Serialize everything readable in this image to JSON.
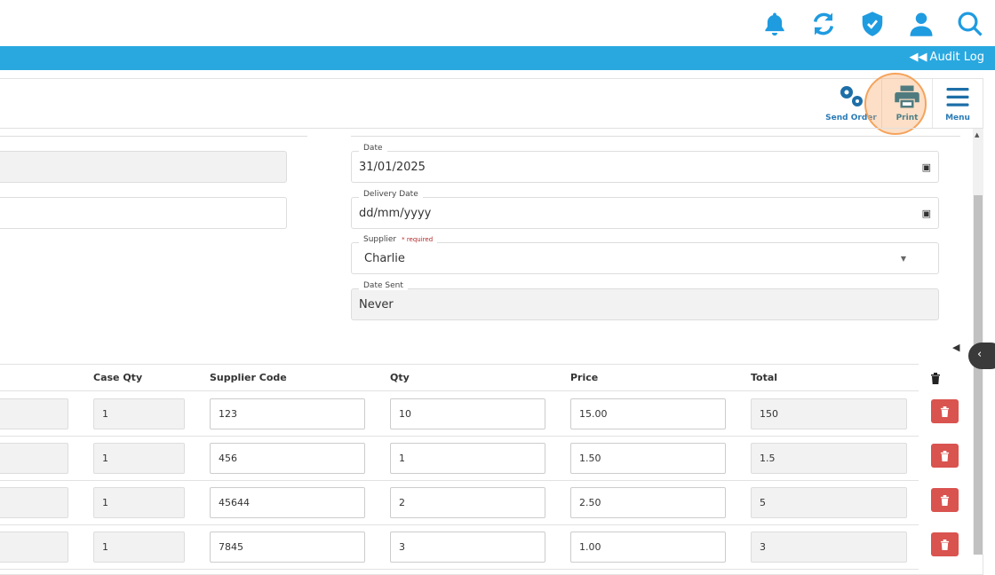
{
  "topbar": {
    "icons": [
      "bell-icon",
      "sync-icon",
      "shield-check-icon",
      "user-icon",
      "search-icon"
    ]
  },
  "bluebar": {
    "audit_log": "Audit Log"
  },
  "toolbar": {
    "send_order": "Send Order",
    "print": "Print",
    "menu": "Menu"
  },
  "form": {
    "date": {
      "label": "Date",
      "value": "31/01/2025"
    },
    "delivery_date": {
      "label": "Delivery Date",
      "value": "dd/mm/yyyy"
    },
    "supplier": {
      "label": "Supplier",
      "required": "* required",
      "value": "Charlie"
    },
    "date_sent": {
      "label": "Date Sent",
      "value": "Never"
    }
  },
  "table": {
    "headers": {
      "case_qty": "Case Qty",
      "supplier_code": "Supplier Code",
      "qty": "Qty",
      "price": "Price",
      "total": "Total"
    },
    "rows": [
      {
        "case_qty": "1",
        "supplier_code": "123",
        "qty": "10",
        "price": "15.00",
        "total": "150"
      },
      {
        "case_qty": "1",
        "supplier_code": "456",
        "qty": "1",
        "price": "1.50",
        "total": "1.5"
      },
      {
        "case_qty": "1",
        "supplier_code": "45644",
        "qty": "2",
        "price": "2.50",
        "total": "5"
      },
      {
        "case_qty": "1",
        "supplier_code": "7845",
        "qty": "3",
        "price": "1.00",
        "total": "3"
      }
    ]
  },
  "colors": {
    "accent": "#29a8e0",
    "icon": "#1f9be0",
    "delete": "#d9534f",
    "highlight": "#f5a35c"
  }
}
